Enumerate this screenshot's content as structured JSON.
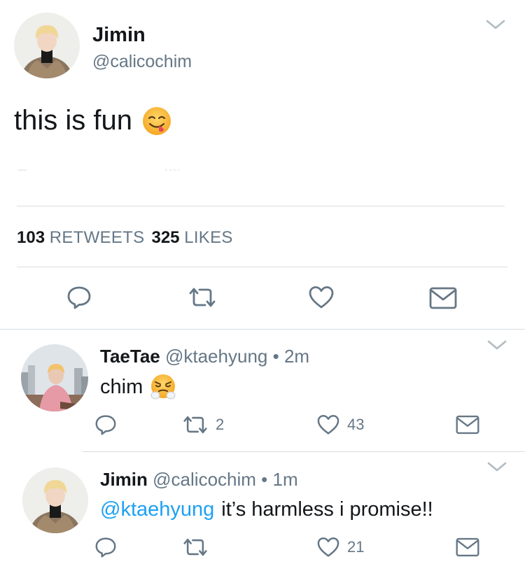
{
  "main_tweet": {
    "name": "Jimin",
    "handle": "@calicochim",
    "text": "this is fun",
    "emoji": "savoring-food-emoji",
    "retweets_count": "103",
    "retweets_label": "RETWEETS",
    "likes_count": "325",
    "likes_label": "LIKES"
  },
  "replies": [
    {
      "name": "TaeTae",
      "handle": "@ktaehyung",
      "dot": "•",
      "time": "2m",
      "text": "chim",
      "emoji": "steam-from-nose-emoji",
      "retweets": "2",
      "likes": "43"
    },
    {
      "name": "Jimin",
      "handle": "@calicochim",
      "dot": "•",
      "time": "1m",
      "mention": "@ktaehyung",
      "text": "it’s harmless i promise!!",
      "retweets": "",
      "likes": "21"
    }
  ],
  "colors": {
    "text": "#14171a",
    "secondary": "#657786",
    "link": "#1da1f2",
    "divider": "#d8dde1",
    "icon": "#657786"
  }
}
